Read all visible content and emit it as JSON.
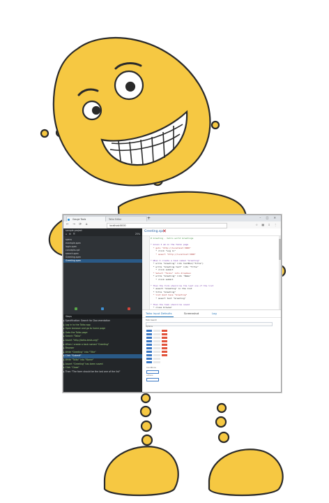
{
  "browser": {
    "tabs": [
      {
        "label": "Gauge Tools"
      },
      {
        "label": "Taiko Editor"
      }
    ],
    "new_tab_symbol": "+",
    "window_controls": "– □ ✕",
    "nav_symbols": "← → ⟳ ⌂",
    "url": "localhost:8000",
    "toolbar_symbols": "☆ ▦ ⇩ ⋮"
  },
  "left_panel": {
    "header_line_1": "sample-project",
    "header_line_2": "⌂  ⚙  ☰",
    "header_zoom": "25%",
    "rows": [
      {
        "label": "specs"
      },
      {
        "label": "  example.spec"
      },
      {
        "label": "  login.spec"
      },
      {
        "label": "  concepts.cpt"
      },
      {
        "label": "  search.spec"
      },
      {
        "label": "  Greeting.spec"
      },
      {
        "label": "  Greeting.spec"
      }
    ]
  },
  "bottom_panel": {
    "title": "Steps",
    "rows": [
      {
        "text": "▸ Specification: Search for Documentation"
      },
      {
        "text": "  ▸ Log in to the Taiko app"
      },
      {
        "text": "    ▸ Open browser and go to home page"
      },
      {
        "text": "      ▸ Goto the Taiko page"
      },
      {
        "text": "        ▸ Search \"Taiko\""
      },
      {
        "text": "          ▸ Assert \"http://taiko-tests.org/\""
      },
      {
        "text": "  ▸ When I create a task named \"Greeting\""
      },
      {
        "text": "    ▸ Browser"
      },
      {
        "text": "      ▸ Write \"Greeting\" into \"Title\""
      },
      {
        "text": "      ▸ Click \"Submit\""
      },
      {
        "text": "      ▸ Write \"Taiko\" into \"Name\""
      },
      {
        "text": "      ▸ Assert \"Greeting\" has been saved"
      },
      {
        "text": "      ▸ Click \"Close\""
      },
      {
        "text": "  ▸ Then \"The form should be the last one of the list\""
      }
    ]
  },
  "editor": {
    "title": "Greeting.spec",
    "close_symbol": "✕",
    "lines": [
      {
        "text": "# Greeting - hello world Greetings"
      },
      {
        "text": ""
      },
      {
        "text": "* Given I am on the Taiko page"
      },
      {
        "text": "  * goto \"http://localhost:3000\""
      },
      {
        "text": "    * click \"Log in\""
      },
      {
        "text": "    * assert \"http://localhost:3000\""
      },
      {
        "text": ""
      },
      {
        "text": "* When I create a task named \"Greeting\""
      },
      {
        "text": "  * write \"Greeting\" into textBox(\"Title\")"
      },
      {
        "text": "  * write \"Greeting text\" into \"Title\""
      },
      {
        "text": "    * click submit"
      },
      {
        "text": "  * Select \"Taiko\" into dropdown"
      },
      {
        "text": "  * write \"Greeting\" into \"Name\""
      },
      {
        "text": "    * click submit"
      },
      {
        "text": ""
      },
      {
        "text": "* Then the form should be the last one of the list"
      },
      {
        "text": "  * assert \"Greeting\" in the list"
      },
      {
        "text": "  * title \"Greeting\""
      },
      {
        "text": "  * list must have \"Greeting\""
      },
      {
        "text": "    * assert text \"Greeting\""
      },
      {
        "text": ""
      },
      {
        "text": "* Then the task should be saved"
      },
      {
        "text": "  * close browser"
      }
    ]
  },
  "results": {
    "tabs": [
      {
        "label": "Taiko Input Defaults"
      },
      {
        "label": "Screenshot"
      },
      {
        "label": "Log"
      }
    ],
    "field_label_1": "Taiko Search",
    "field_label_2": "Options",
    "footer_label_1": "Conditions",
    "footer_label_2": "Actions"
  },
  "colors": {
    "robot_yellow": "#f6c842",
    "robot_outline": "#2a2a2a",
    "dark_panel": "#2f3337",
    "accent_blue": "#1e6fb5",
    "close_red": "#e0302d"
  }
}
